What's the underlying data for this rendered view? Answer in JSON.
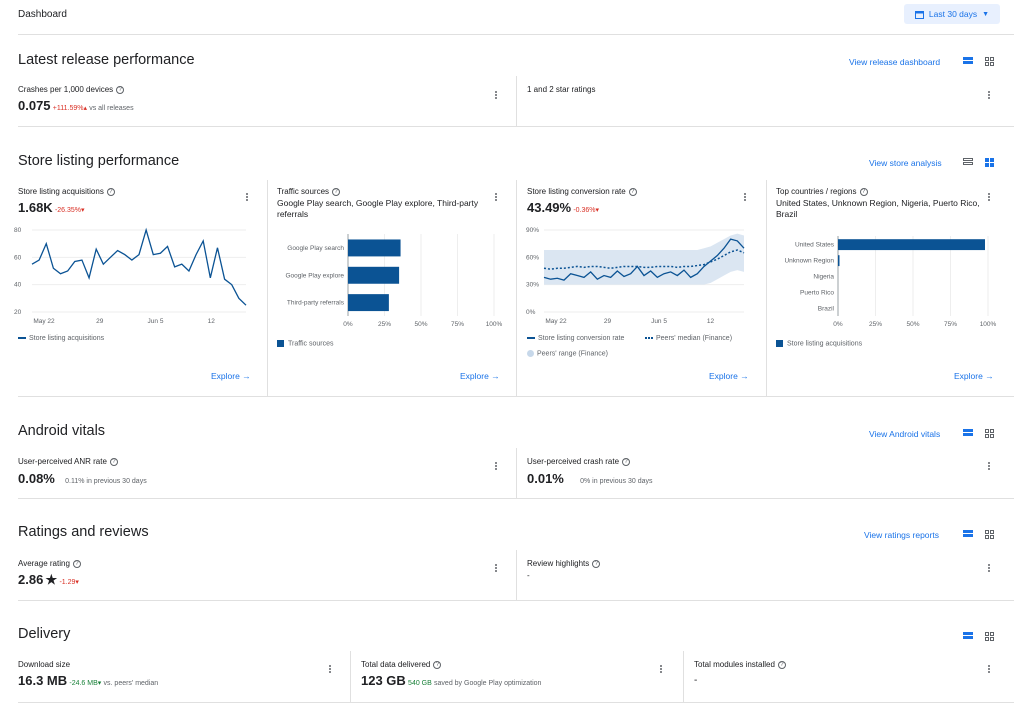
{
  "header": {
    "title": "Dashboard",
    "date_range": "Last 30 days"
  },
  "latest_release": {
    "title": "Latest release performance",
    "link": "View release dashboard",
    "crashes": {
      "label": "Crashes per 1,000 devices",
      "value": "0.075",
      "change": "+111.59%",
      "compare": "vs all releases"
    },
    "ratings": {
      "label": "1 and 2 star ratings"
    }
  },
  "store_listing": {
    "title": "Store listing performance",
    "link": "View store analysis",
    "acquisitions": {
      "label": "Store listing acquisitions",
      "value": "1.68K",
      "change": "-26.35%",
      "legend": "Store listing acquisitions",
      "explore": "Explore"
    },
    "traffic": {
      "label": "Traffic sources",
      "subtitle": "Google Play search, Google Play explore, Third-party referrals",
      "legend": "Traffic sources",
      "explore": "Explore"
    },
    "conversion": {
      "label": "Store listing conversion rate",
      "value": "43.49%",
      "change": "-0.36%",
      "legend_a": "Store listing conversion rate",
      "legend_b": "Peers' median (Finance)",
      "legend_c": "Peers' range (Finance)",
      "explore": "Explore"
    },
    "countries": {
      "label": "Top countries / regions",
      "subtitle": "United States, Unknown Region, Nigeria, Puerto Rico, Brazil",
      "legend": "Store listing acquisitions",
      "explore": "Explore"
    }
  },
  "vitals": {
    "title": "Android vitals",
    "link": "View Android vitals",
    "anr": {
      "label": "User-perceived ANR rate",
      "value": "0.08%",
      "compare": "0.11% in previous 30 days"
    },
    "crash": {
      "label": "User-perceived crash rate",
      "value": "0.01%",
      "compare": "0% in previous 30 days"
    }
  },
  "ratings": {
    "title": "Ratings and reviews",
    "link": "View ratings reports",
    "average": {
      "label": "Average rating",
      "value": "2.86",
      "change": "-1.29"
    },
    "highlights": {
      "label": "Review highlights",
      "value": "-"
    }
  },
  "delivery": {
    "title": "Delivery",
    "download": {
      "label": "Download size",
      "value": "16.3 MB",
      "change": "-24.6 MB",
      "compare": "vs. peers' median"
    },
    "data": {
      "label": "Total data delivered",
      "value": "123 GB",
      "saved": "540 GB",
      "saved_text": "saved by Google Play optimization"
    },
    "modules": {
      "label": "Total modules installed",
      "value": "-"
    }
  },
  "chart_data": [
    {
      "type": "line",
      "x_ticks": [
        "May 22",
        "29",
        "Jun 5",
        "12"
      ],
      "y_ticks": [
        "80",
        "60",
        "40",
        "20"
      ],
      "ylim": [
        20,
        80
      ],
      "series": [
        {
          "name": "Store listing acquisitions",
          "values": [
            55,
            58,
            70,
            52,
            48,
            50,
            57,
            58,
            45,
            66,
            55,
            60,
            65,
            62,
            58,
            62,
            80,
            62,
            63,
            68,
            53,
            55,
            50,
            62,
            72,
            45,
            67,
            44,
            40,
            30,
            25
          ]
        }
      ]
    },
    {
      "type": "bar",
      "categories": [
        "Google Play search",
        "Google Play explore",
        "Third-party referrals"
      ],
      "series": [
        {
          "name": "Traffic sources",
          "values": [
            36,
            35,
            28
          ]
        }
      ],
      "x_ticks": [
        "0%",
        "25%",
        "50%",
        "75%",
        "100%"
      ],
      "xlim": [
        0,
        100
      ]
    },
    {
      "type": "line",
      "x_ticks": [
        "May 22",
        "29",
        "Jun 5",
        "12"
      ],
      "y_ticks": [
        "90%",
        "60%",
        "30%",
        "0%"
      ],
      "ylim": [
        0,
        90
      ],
      "series": [
        {
          "name": "Store listing conversion rate",
          "values": [
            38,
            36,
            37,
            35,
            42,
            40,
            38,
            44,
            36,
            40,
            38,
            45,
            39,
            42,
            50,
            40,
            45,
            38,
            42,
            44,
            40,
            46,
            38,
            42,
            50,
            56,
            62,
            70,
            80,
            78,
            70
          ]
        },
        {
          "name": "Peers' median (Finance)",
          "values": [
            48,
            47,
            48,
            48,
            49,
            50,
            49,
            50,
            50,
            49,
            48,
            49,
            50,
            50,
            50,
            49,
            49,
            50,
            50,
            50,
            49,
            50,
            50,
            51,
            52,
            55,
            58,
            62,
            66,
            68,
            65
          ]
        },
        {
          "name": "Peers' range (Finance)",
          "low": [
            30,
            30,
            30,
            30,
            30,
            30,
            30,
            30,
            30,
            30,
            30,
            30,
            30,
            30,
            30,
            30,
            30,
            30,
            30,
            30,
            30,
            30,
            30,
            30,
            30,
            32,
            36,
            40,
            44,
            46,
            44
          ],
          "high": [
            68,
            68,
            68,
            68,
            68,
            68,
            68,
            68,
            68,
            68,
            68,
            68,
            68,
            68,
            68,
            68,
            68,
            68,
            68,
            68,
            68,
            68,
            68,
            68,
            70,
            72,
            76,
            80,
            84,
            86,
            84
          ]
        }
      ]
    },
    {
      "type": "bar",
      "categories": [
        "United States",
        "Unknown Region",
        "Nigeria",
        "Puerto Rico",
        "Brazil"
      ],
      "series": [
        {
          "name": "Store listing acquisitions",
          "values": [
            98,
            1,
            0,
            0,
            0
          ]
        }
      ],
      "x_ticks": [
        "0%",
        "25%",
        "50%",
        "75%",
        "100%"
      ],
      "xlim": [
        0,
        100
      ]
    }
  ]
}
